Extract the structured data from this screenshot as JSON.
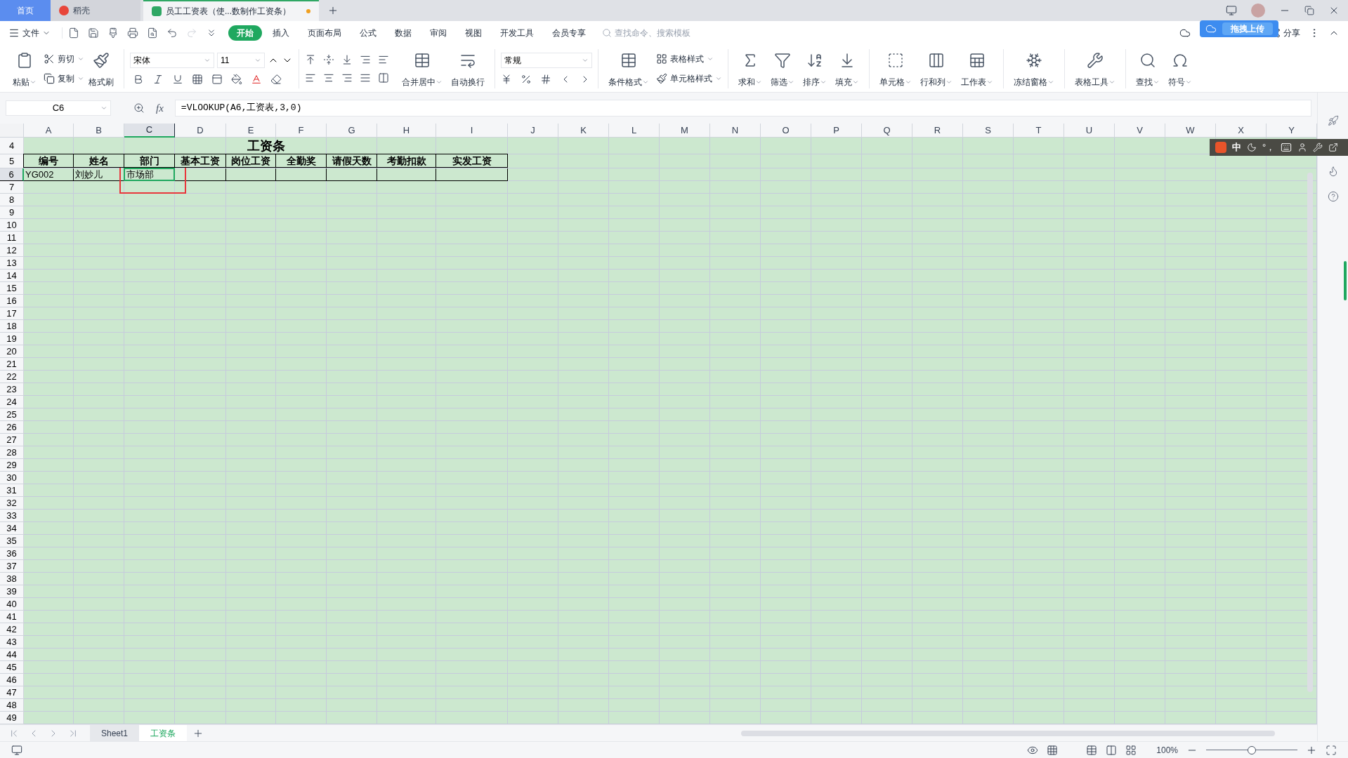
{
  "title_bar": {
    "tabs": [
      {
        "label": "首页",
        "kind": "home",
        "selected": false
      },
      {
        "label": "稻壳",
        "kind": "docer",
        "selected": false
      },
      {
        "label": "员工工资表（使...数制作工资条）",
        "kind": "sheet",
        "selected": true,
        "unsaved": true
      }
    ]
  },
  "upload_popup": {
    "label": "拖拽上传"
  },
  "menu": {
    "file": "文件",
    "tabs": [
      {
        "label": "开始",
        "selected": true
      },
      {
        "label": "插入",
        "selected": false
      },
      {
        "label": "页面布局",
        "selected": false
      },
      {
        "label": "公式",
        "selected": false
      },
      {
        "label": "数据",
        "selected": false
      },
      {
        "label": "审阅",
        "selected": false
      },
      {
        "label": "视图",
        "selected": false
      },
      {
        "label": "开发工具",
        "selected": false
      },
      {
        "label": "会员专享",
        "selected": false
      }
    ],
    "search": {
      "placeholder": "查找命令、搜索模板"
    },
    "share": "分享"
  },
  "ribbon": {
    "clipboard": [
      {
        "label": "粘贴",
        "kind": "large"
      },
      {
        "label": "剪切",
        "kind": "small"
      },
      {
        "label": "复制",
        "kind": "small"
      },
      {
        "label": "格式刷",
        "kind": "large"
      }
    ],
    "font": {
      "family": "宋体",
      "size": "11"
    },
    "alignment": [
      {
        "label": "合并居中"
      },
      {
        "label": "自动换行"
      }
    ],
    "number": {
      "format": "常规"
    },
    "styles": [
      {
        "label": "条件格式",
        "kind": "large"
      },
      {
        "label": "表格样式",
        "kind": "small"
      },
      {
        "label": "单元格样式",
        "kind": "small"
      }
    ],
    "tools": [
      {
        "label": "求和"
      },
      {
        "label": "筛选"
      },
      {
        "label": "排序"
      },
      {
        "label": "填充"
      },
      {
        "label": "单元格"
      },
      {
        "label": "行和列"
      },
      {
        "label": "工作表"
      },
      {
        "label": "冻结窗格"
      },
      {
        "label": "表格工具"
      },
      {
        "label": "查找"
      },
      {
        "label": "符号"
      }
    ]
  },
  "formula_bar": {
    "name_box": "C6",
    "fx_label": "fx",
    "formula": "=VLOOKUP(A6,工资表,3,0)"
  },
  "sheet": {
    "columns": [
      {
        "label": "A",
        "selected": false
      },
      {
        "label": "B",
        "selected": false
      },
      {
        "label": "C",
        "selected": true
      },
      {
        "label": "D",
        "selected": false
      },
      {
        "label": "E",
        "selected": false
      },
      {
        "label": "F",
        "selected": false
      },
      {
        "label": "G",
        "selected": false
      },
      {
        "label": "H",
        "selected": false
      },
      {
        "label": "I",
        "selected": false
      },
      {
        "label": "J",
        "selected": false
      },
      {
        "label": "K",
        "selected": false
      },
      {
        "label": "L",
        "selected": false
      },
      {
        "label": "M",
        "selected": false
      },
      {
        "label": "N",
        "selected": false
      },
      {
        "label": "O",
        "selected": false
      },
      {
        "label": "P",
        "selected": false
      },
      {
        "label": "Q",
        "selected": false
      },
      {
        "label": "R",
        "selected": false
      },
      {
        "label": "S",
        "selected": false
      },
      {
        "label": "T",
        "selected": false
      },
      {
        "label": "U",
        "selected": false
      },
      {
        "label": "V",
        "selected": false
      },
      {
        "label": "W",
        "selected": false
      },
      {
        "label": "X",
        "selected": false
      },
      {
        "label": "Y",
        "selected": false
      }
    ],
    "rows": [
      {
        "label": "4",
        "selected": false
      },
      {
        "label": "5",
        "selected": false
      },
      {
        "label": "6",
        "selected": true
      },
      {
        "label": "7",
        "selected": false
      },
      {
        "label": "8",
        "selected": false
      },
      {
        "label": "9",
        "selected": false
      },
      {
        "label": "10",
        "selected": false
      },
      {
        "label": "11",
        "selected": false
      },
      {
        "label": "12",
        "selected": false
      },
      {
        "label": "13",
        "selected": false
      },
      {
        "label": "14",
        "selected": false
      },
      {
        "label": "15",
        "selected": false
      },
      {
        "label": "16",
        "selected": false
      },
      {
        "label": "17",
        "selected": false
      },
      {
        "label": "18",
        "selected": false
      },
      {
        "label": "19",
        "selected": false
      },
      {
        "label": "20",
        "selected": false
      },
      {
        "label": "21",
        "selected": false
      },
      {
        "label": "22",
        "selected": false
      },
      {
        "label": "23",
        "selected": false
      },
      {
        "label": "24",
        "selected": false
      },
      {
        "label": "25",
        "selected": false
      },
      {
        "label": "26",
        "selected": false
      },
      {
        "label": "27",
        "selected": false
      },
      {
        "label": "28",
        "selected": false
      },
      {
        "label": "29",
        "selected": false
      },
      {
        "label": "30",
        "selected": false
      },
      {
        "label": "31",
        "selected": false
      },
      {
        "label": "32",
        "selected": false
      },
      {
        "label": "33",
        "selected": false
      },
      {
        "label": "34",
        "selected": false
      },
      {
        "label": "35",
        "selected": false
      },
      {
        "label": "36",
        "selected": false
      },
      {
        "label": "37",
        "selected": false
      },
      {
        "label": "38",
        "selected": false
      },
      {
        "label": "39",
        "selected": false
      },
      {
        "label": "40",
        "selected": false
      },
      {
        "label": "41",
        "selected": false
      },
      {
        "label": "42",
        "selected": false
      },
      {
        "label": "43",
        "selected": false
      },
      {
        "label": "44",
        "selected": false
      },
      {
        "label": "45",
        "selected": false
      },
      {
        "label": "46",
        "selected": false
      },
      {
        "label": "47",
        "selected": false
      },
      {
        "label": "48",
        "selected": false
      },
      {
        "label": "49",
        "selected": false
      }
    ],
    "title": "工资条",
    "headers": [
      "编号",
      "姓名",
      "部门",
      "基本工资",
      "岗位工资",
      "全勤奖",
      "请假天数",
      "考勤扣款",
      "实发工资"
    ],
    "records": [
      {
        "cells": [
          {
            "text": "YG002",
            "selected": false
          },
          {
            "text": "刘妙儿",
            "selected": false
          },
          {
            "text": "市场部",
            "selected": true
          }
        ]
      }
    ]
  },
  "ime_bar": {
    "mode": "中",
    "punct": "°，"
  },
  "sheet_tabs": [
    {
      "label": "Sheet1",
      "selected": false
    },
    {
      "label": "工资条",
      "selected": true
    }
  ],
  "status_bar": {
    "zoom": "100%",
    "zoom_slider": {
      "level": 0.5
    }
  }
}
